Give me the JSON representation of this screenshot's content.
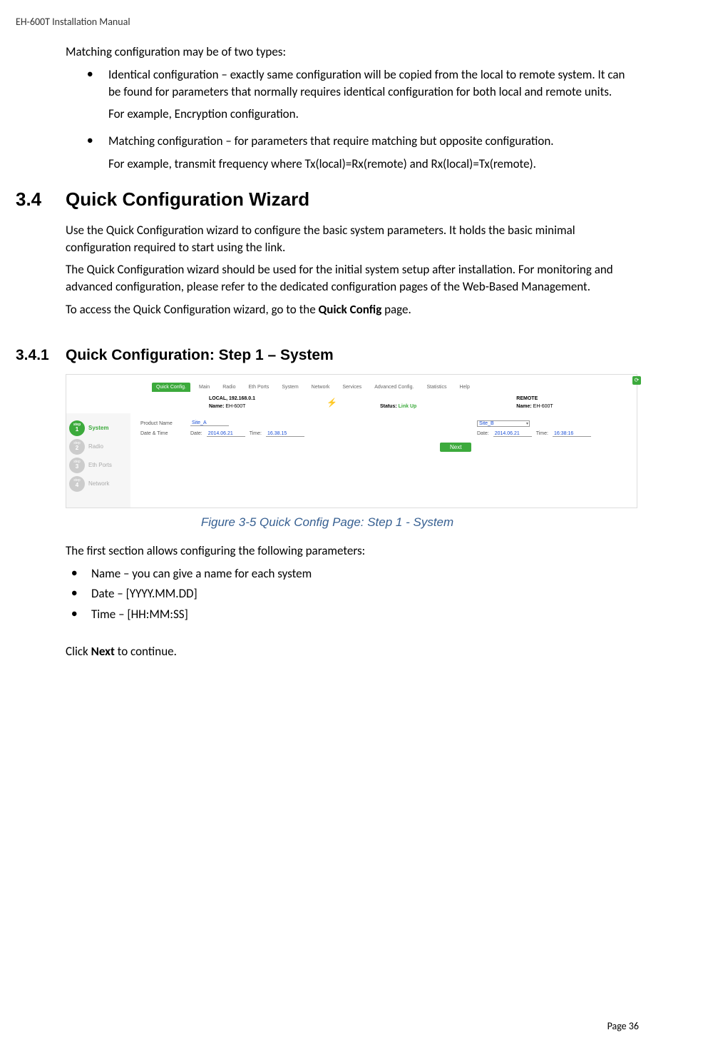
{
  "header": "EH-600T Installation Manual",
  "intro": "Matching configuration may be of two types:",
  "bullets_top": [
    {
      "main": "Identical configuration – exactly same configuration will be copied from the local to remote system. It can be found for parameters that normally requires identical configuration for both local and remote units.",
      "sub": "For example, Encryption configuration."
    },
    {
      "main": " Matching configuration – for parameters that require matching but opposite configuration.",
      "sub": "For example, transmit frequency where Tx(local)=Rx(remote) and Rx(local)=Tx(remote)."
    }
  ],
  "sec34": {
    "num": "3.4",
    "title": "Quick Configuration Wizard",
    "p1": "Use the Quick Configuration wizard to configure the basic system parameters. It holds the basic minimal configuration required to start using the link.",
    "p2": "The Quick Configuration wizard should be used for the initial system setup after installation. For monitoring and advanced configuration, please refer to the dedicated configuration pages of the Web-Based Management.",
    "p3_pre": "To access the Quick Configuration wizard, go to the ",
    "p3_bold": "Quick Config",
    "p3_post": " page."
  },
  "sec341": {
    "num": "3.4.1",
    "title": "Quick Configuration: Step 1 – System"
  },
  "shot": {
    "tabs": [
      "Quick Config.",
      "Main",
      "Radio",
      "Eth Ports",
      "System",
      "Network",
      "Services",
      "Advanced Config.",
      "Statistics",
      "Help"
    ],
    "local_label": "LOCAL, 192.168.0.1",
    "local_name_lbl": "Name:",
    "local_name": "EH-600T",
    "status_lbl": "Status:",
    "status_val": "Link Up",
    "remote_label": "REMOTE",
    "remote_name_lbl": "Name:",
    "remote_name": "EH-600T",
    "steps": [
      "System",
      "Radio",
      "Eth Ports",
      "Network"
    ],
    "row_product": "Product Name",
    "prod_local": "Site_A",
    "prod_remote": "Site_B",
    "row_dt": "Date & Time",
    "date_lbl": "Date:",
    "time_lbl": "Time:",
    "date_local": "2014.06.21",
    "time_local": "16.38.15",
    "date_remote": "2014.06.21",
    "time_remote": "16:38:16",
    "next": "Next"
  },
  "caption": "Figure 3-5 Quick Config Page: Step 1 - System",
  "after_fig": "The first section allows configuring the following parameters:",
  "bullets2": [
    "Name – you can give a name for each system",
    "Date – [YYYY.MM.DD]",
    "Time – [HH:MM:SS]"
  ],
  "click_pre": "Click ",
  "click_bold": "Next",
  "click_post": " to continue.",
  "footer": "Page 36"
}
